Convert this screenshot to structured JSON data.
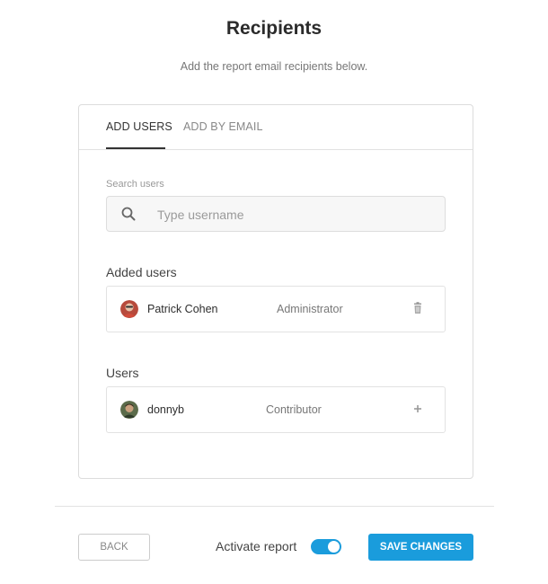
{
  "header": {
    "title": "Recipients",
    "subtitle": "Add the report email recipients below."
  },
  "tabs": [
    {
      "label": "ADD USERS",
      "active": true
    },
    {
      "label": "ADD BY EMAIL",
      "active": false
    }
  ],
  "search": {
    "label": "Search users",
    "placeholder": "Type username",
    "value": "",
    "icon": "search-icon"
  },
  "added_users": {
    "title": "Added users",
    "items": [
      {
        "name": "Patrick Cohen",
        "role": "Administrator",
        "action_icon": "trash-icon"
      }
    ]
  },
  "users": {
    "title": "Users",
    "items": [
      {
        "name": "donnyb",
        "role": "Contributor",
        "action_icon": "plus-icon"
      }
    ]
  },
  "footer": {
    "back_label": "BACK",
    "activate_label": "Activate report",
    "activate_on": true,
    "save_label": "SAVE CHANGES"
  },
  "colors": {
    "accent": "#1a9cdc",
    "text": "#333333",
    "muted": "#777777",
    "border": "#dcdcdc"
  }
}
